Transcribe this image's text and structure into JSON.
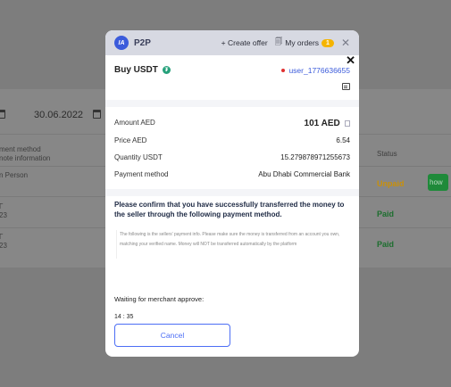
{
  "background": {
    "date": "30.06.2022",
    "col_payment_line1": "ment method",
    "col_payment_line2": "note information",
    "col_status": "Status",
    "row1_method": "n Person",
    "row1_status": "Unpaid",
    "row1_button": "how",
    "row2_status": "Paid",
    "row3_status": "Paid",
    "row2_frag1": "Г",
    "row2_frag2": "23",
    "row3_frag1": "Г",
    "row3_frag2": "23",
    "colors": {
      "unpaid": "#c9900a",
      "paid": "#1c6e2e"
    }
  },
  "header": {
    "logo_text": "IA",
    "brand": "P2P",
    "create_offer": "+ Create offer",
    "my_orders": "My orders",
    "orders_count": "1"
  },
  "order": {
    "title": "Buy USDT",
    "user": "user_1776636655",
    "rows": [
      {
        "label": "Amount AED",
        "value": "101 AED"
      },
      {
        "label": "Price AED",
        "value": "6.54"
      },
      {
        "label": "Quantity USDT",
        "value": "15.279878971255673"
      },
      {
        "label": "Payment method",
        "value": "Abu Dhabi Commercial Bank"
      }
    ],
    "confirm_text": "Please confirm that you have successfully transferred the money to the seller through the following payment method.",
    "note_text": "The following is the sellers' payment info. Please make sure the money is transferred from an account you own, matching your verified name. Money will NOT be transferred automatically by the platform",
    "waiting_text": "Waiting for merchant approve:",
    "timer": "14 : 35",
    "cancel_label": "Cancel"
  },
  "icons": {
    "calendar": "calendar-icon",
    "usdt": "usdt-icon",
    "chat": "chat-icon",
    "copy": "copy-icon",
    "close": "close-icon",
    "orders": "orders-icon"
  }
}
